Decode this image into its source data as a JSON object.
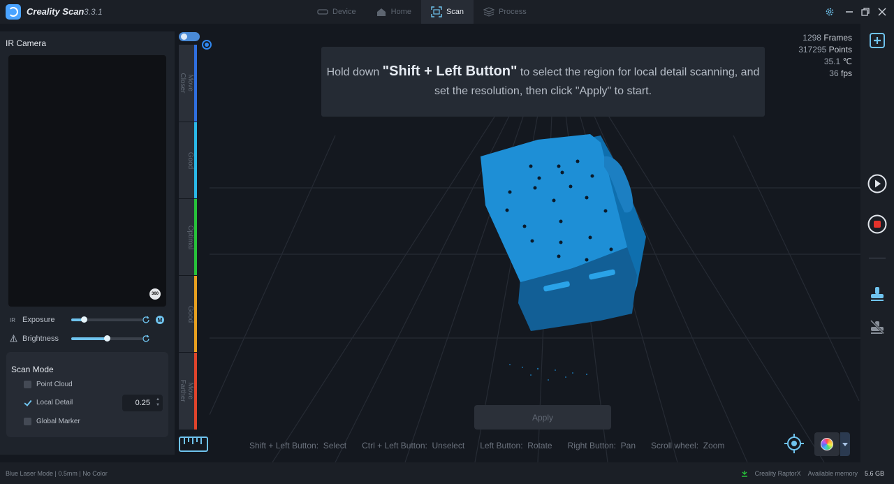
{
  "app": {
    "name": "Creality Scan",
    "version": "3.3.1"
  },
  "nav": {
    "tabs": [
      {
        "label": "Device",
        "icon": "device-icon"
      },
      {
        "label": "Home",
        "icon": "home-icon"
      },
      {
        "label": "Scan",
        "icon": "scan-icon",
        "active": true
      },
      {
        "label": "Process",
        "icon": "process-icon"
      }
    ]
  },
  "left": {
    "ir_title": "IR Camera",
    "exposure": {
      "prefix": "IR",
      "label": "Exposure",
      "level": 0.18,
      "mode_badge": "M"
    },
    "brightness": {
      "label": "Brightness",
      "level": 0.5
    },
    "scan_mode": {
      "title": "Scan Mode",
      "options": [
        {
          "label": "Point Cloud",
          "checked": false
        },
        {
          "label": "Local Detail",
          "checked": true
        },
        {
          "label": "Global Marker",
          "checked": false
        }
      ],
      "resolution": "0.25"
    },
    "cam360_label": "360"
  },
  "distance": {
    "segments": [
      {
        "label": "Move Closer",
        "color": "#2f6fe0"
      },
      {
        "label": "Good",
        "color": "#2ab8e8"
      },
      {
        "label": "Optimal",
        "color": "#27c23a"
      },
      {
        "label": "Good",
        "color": "#e8a020"
      },
      {
        "label": "Move Farther",
        "color": "#e0442c"
      }
    ]
  },
  "stats": [
    {
      "value": "1298",
      "unit": "Frames"
    },
    {
      "value": "317295",
      "unit": "Points"
    },
    {
      "value": "35.1",
      "unit": "℃"
    },
    {
      "value": "36",
      "unit": "fps"
    }
  ],
  "hint": {
    "pre": "Hold down ",
    "emph": "\"Shift + Left Button\"",
    "post": " to select the region for local detail scanning, and set the resolution, then click \"Apply\" to start."
  },
  "apply_label": "Apply",
  "shortcuts": [
    {
      "key": "Shift + Left Button:",
      "action": "Select"
    },
    {
      "key": "Ctrl + Left Button:",
      "action": "Unselect"
    },
    {
      "key": "Left Button:",
      "action": "Rotate"
    },
    {
      "key": "Right Button:",
      "action": "Pan"
    },
    {
      "key": "Scroll wheel:",
      "action": "Zoom"
    }
  ],
  "status": {
    "left": "Blue Laser Mode | 0.5mm | No Color",
    "device": "Creality RaptorX",
    "mem_label": "Available memory",
    "mem_value": "5.6 GB"
  },
  "colors": {
    "accent": "#6fc3ee",
    "scan_blue": "#1e8fd6",
    "background": "#14181f"
  }
}
